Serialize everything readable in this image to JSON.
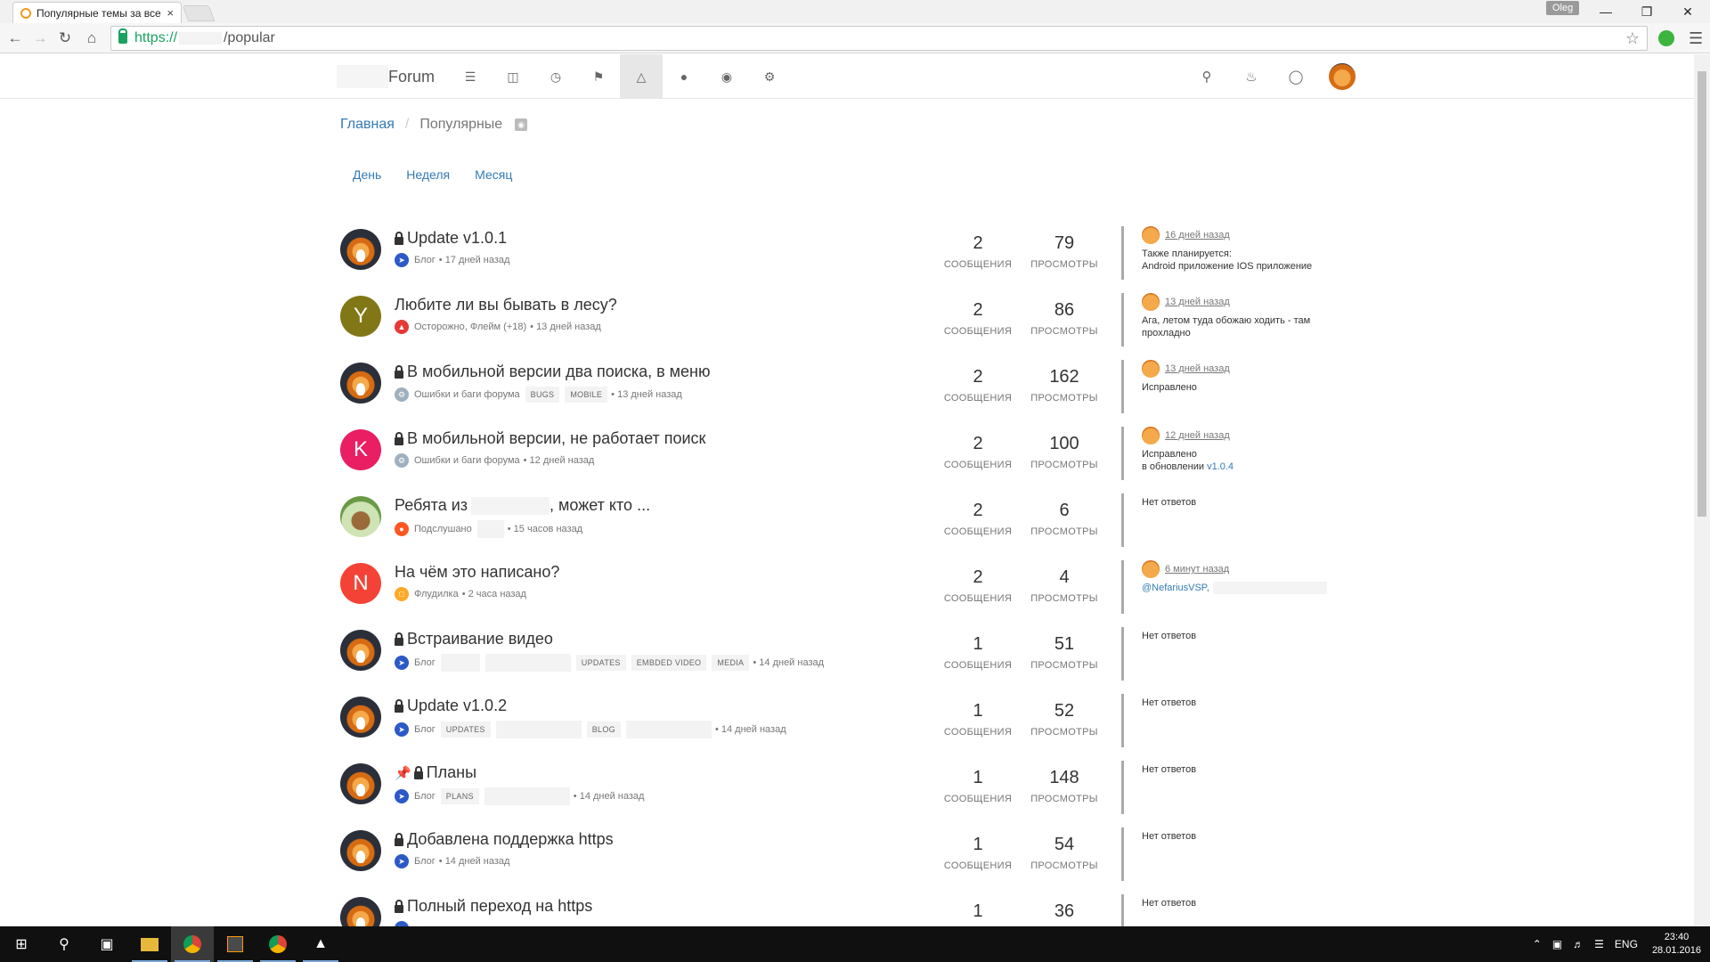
{
  "browser": {
    "tab_title": "Популярные темы за все",
    "tab_close": "×",
    "profile_name": "Oleg",
    "url_scheme": "https://",
    "url_path": "/popular"
  },
  "header": {
    "brand": "Forum"
  },
  "breadcrumb": {
    "home": "Главная",
    "sep": "/",
    "current": "Популярные"
  },
  "periods": [
    "День",
    "Неделя",
    "Месяц"
  ],
  "labels": {
    "posts": "СООБЩЕНИЯ",
    "views": "ПРОСМОТРЫ",
    "no_replies": "Нет ответов"
  },
  "topics": [
    {
      "title": "Update v1.0.1",
      "locked": true,
      "pinned": false,
      "avatar_type": "fox",
      "avatar_letter": "",
      "avatar_color": "",
      "category": "Блог",
      "category_color": "#2c59c8",
      "category_icon": "paper-plane-icon",
      "tags": [],
      "time": "• 17 дней назад",
      "posts": "2",
      "views": "79",
      "teaser": {
        "has_reply": true,
        "time": "16 дней назад",
        "lines": [
          "Также планируется:",
          "Android приложение IOS приложение"
        ]
      }
    },
    {
      "title": "Любите ли вы бывать в лесу?",
      "locked": false,
      "pinned": false,
      "avatar_type": "letter",
      "avatar_letter": "Y",
      "avatar_color": "#827717",
      "category": "Осторожно, Флейм (+18)",
      "category_color": "#e53935",
      "category_icon": "flame-icon",
      "tags": [],
      "time": "• 13 дней назад",
      "posts": "2",
      "views": "86",
      "teaser": {
        "has_reply": true,
        "time": "13 дней назад",
        "lines": [
          "Ага, летом туда обожаю ходить - там",
          "прохладно"
        ]
      }
    },
    {
      "title": "В мобильной версии два поиска, в меню",
      "locked": true,
      "pinned": false,
      "avatar_type": "fox",
      "avatar_letter": "",
      "avatar_color": "",
      "category": "Ошибки и баги форума",
      "category_color": "#9fb0bf",
      "category_icon": "bug-icon",
      "tags": [
        "BUGS",
        "MOBILE"
      ],
      "time": "• 13 дней назад",
      "posts": "2",
      "views": "162",
      "teaser": {
        "has_reply": true,
        "time": "13 дней назад",
        "lines": [
          "Исправлено"
        ]
      }
    },
    {
      "title": "В мобильной версии, не работает поиск",
      "locked": true,
      "pinned": false,
      "avatar_type": "letter",
      "avatar_letter": "K",
      "avatar_color": "#e91e63",
      "category": "Ошибки и баги форума",
      "category_color": "#9fb0bf",
      "category_icon": "bug-icon",
      "tags": [],
      "time": "• 12 дней назад",
      "posts": "2",
      "views": "100",
      "teaser": {
        "has_reply": true,
        "time": "12 дней назад",
        "lines": [
          "Исправлено"
        ],
        "extra_prefix": "в обновлении ",
        "extra_link": "v1.0.4"
      }
    },
    {
      "title_prefix": "Ребята из",
      "title_suffix": ", может кто ...",
      "locked": false,
      "pinned": false,
      "avatar_type": "deer",
      "avatar_letter": "",
      "avatar_color": "",
      "category": "Подслушано",
      "category_color": "#ff5722",
      "category_icon": "ear-icon",
      "tags": [],
      "time": "• 15 часов назад",
      "posts": "2",
      "views": "6",
      "teaser": {
        "has_reply": false
      }
    },
    {
      "title": "На чём это написано?",
      "locked": false,
      "pinned": false,
      "avatar_type": "letter",
      "avatar_letter": "N",
      "avatar_color": "#f44336",
      "category": "Флудилка",
      "category_color": "#ffa726",
      "category_icon": "chat-icon",
      "tags": [],
      "time": "• 2 часа назад",
      "posts": "2",
      "views": "4",
      "teaser": {
        "has_reply": true,
        "time": "6 минут назад",
        "lines": [],
        "mention": "@NefariusVSP,"
      }
    },
    {
      "title": "Встраивание видео",
      "locked": true,
      "pinned": false,
      "avatar_type": "fox",
      "avatar_letter": "",
      "avatar_color": "",
      "category": "Блог",
      "category_color": "#2c59c8",
      "category_icon": "paper-plane-icon",
      "tags": [
        "",
        "",
        "UPDATES",
        "EMBDED VIDEO",
        "MEDIA"
      ],
      "time": "• 14 дней назад",
      "posts": "1",
      "views": "51",
      "teaser": {
        "has_reply": false
      }
    },
    {
      "title": "Update v1.0.2",
      "locked": true,
      "pinned": false,
      "avatar_type": "fox",
      "avatar_letter": "",
      "avatar_color": "",
      "category": "Блог",
      "category_color": "#2c59c8",
      "category_icon": "paper-plane-icon",
      "tags": [
        "UPDATES",
        "",
        "BLOG",
        ""
      ],
      "time": "• 14 дней назад",
      "posts": "1",
      "views": "52",
      "teaser": {
        "has_reply": false
      }
    },
    {
      "title": "Планы",
      "locked": true,
      "pinned": true,
      "avatar_type": "fox",
      "avatar_letter": "",
      "avatar_color": "",
      "category": "Блог",
      "category_color": "#2c59c8",
      "category_icon": "paper-plane-icon",
      "tags": [
        "PLANS",
        ""
      ],
      "time": "• 14 дней назад",
      "posts": "1",
      "views": "148",
      "teaser": {
        "has_reply": false
      }
    },
    {
      "title": "Добавлена поддержка https",
      "locked": true,
      "pinned": false,
      "avatar_type": "fox",
      "avatar_letter": "",
      "avatar_color": "",
      "category": "Блог",
      "category_color": "#2c59c8",
      "category_icon": "paper-plane-icon",
      "tags": [],
      "time": "• 14 дней назад",
      "posts": "1",
      "views": "54",
      "teaser": {
        "has_reply": false
      }
    },
    {
      "title": "Полный переход на https",
      "locked": true,
      "pinned": false,
      "avatar_type": "fox",
      "avatar_letter": "",
      "avatar_color": "",
      "category": "",
      "category_color": "#2c59c8",
      "category_icon": "paper-plane-icon",
      "tags": [],
      "time": "",
      "posts": "1",
      "views": "36",
      "teaser": {
        "has_reply": false
      }
    }
  ],
  "taskbar": {
    "language": "ENG",
    "time": "23:40",
    "date": "28.01.2016"
  }
}
